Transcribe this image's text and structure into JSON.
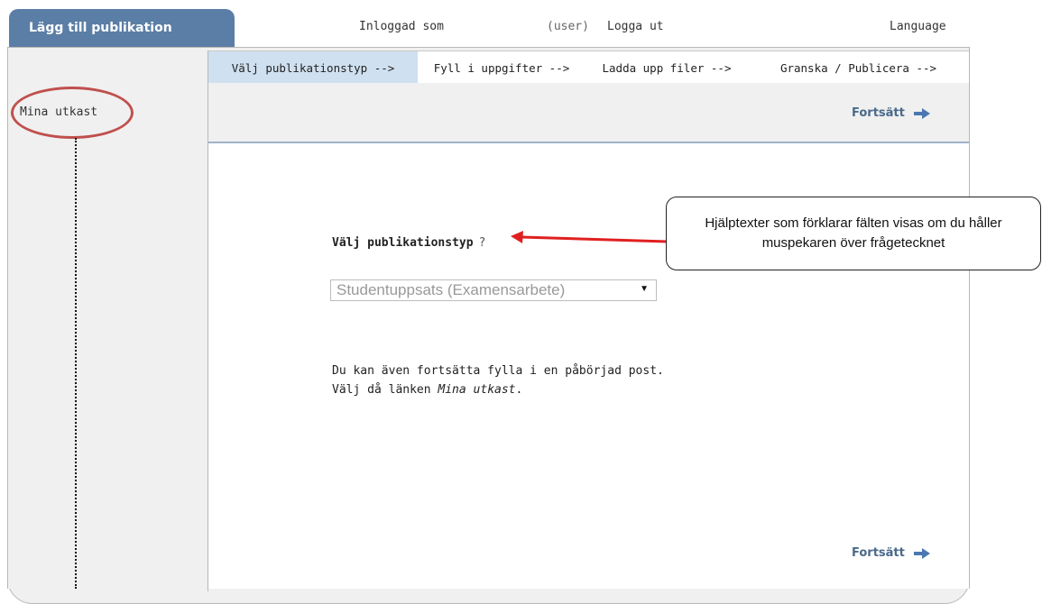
{
  "header": {
    "app_tab": "Lägg till publikation",
    "logged_in_label": "Inloggad som",
    "user": "(user)",
    "logout": "Logga ut",
    "language": "Language"
  },
  "sidebar": {
    "drafts_link": "Mina utkast"
  },
  "steps": [
    {
      "label": "Välj publikationstyp -->",
      "active": true
    },
    {
      "label": "Fyll i uppgifter -->",
      "active": false
    },
    {
      "label": "Ladda upp filer -->",
      "active": false
    },
    {
      "label": "Granska / Publicera -->",
      "active": false
    }
  ],
  "actions": {
    "continue_top": "Fortsätt",
    "continue_bottom": "Fortsätt"
  },
  "form": {
    "type_label": "Välj publikationstyp",
    "help_mark": "?",
    "type_selected": "Studentuppsats (Examensarbete)"
  },
  "info": {
    "line1": "Du kan även fortsätta fylla i en påbörjad post.",
    "line2_prefix": "Välj då länken ",
    "line2_link": "Mina utkast",
    "line2_suffix": "."
  },
  "annotation": {
    "callout": "Hjälptexter som förklarar fälten visas om du håller muspekaren över frågetecknet"
  },
  "colors": {
    "tab_bg": "#5b7ea6",
    "active_step_bg": "#cfe0f0",
    "highlight_ellipse": "#c0504d",
    "arrow_red": "#e02020",
    "continue_arrow": "#4b78b0"
  }
}
